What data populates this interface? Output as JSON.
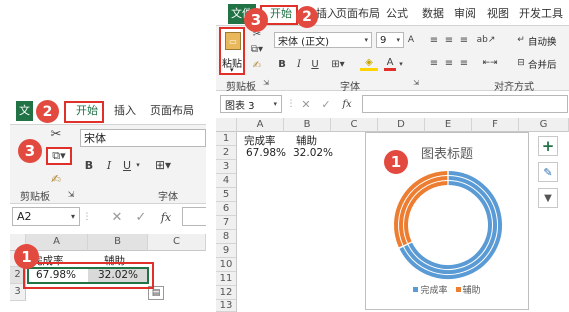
{
  "left": {
    "tabs": {
      "file": "文",
      "home": "开始",
      "insert": "插入",
      "page_layout": "页面布局"
    },
    "clipboard_label": "剪贴板",
    "font_group_label": "字体",
    "font_name": "宋体",
    "bold": "B",
    "italic": "I",
    "underline": "U",
    "namebox": "A2",
    "fx": "fx",
    "columns": [
      "A",
      "B",
      "C"
    ],
    "rows": [
      "1",
      "2",
      "3"
    ],
    "cells": {
      "a1": "完成率",
      "b1": "辅助",
      "a2": "67.98%",
      "b2": "32.02%"
    },
    "badges": {
      "one": "1",
      "two": "2",
      "three": "3"
    }
  },
  "right": {
    "tabs": {
      "file": "文件",
      "home": "开始",
      "insert": "插入",
      "page_layout": "页面布局",
      "formulas": "公式",
      "data": "数据",
      "review": "审阅",
      "view": "视图",
      "developer": "开发工具"
    },
    "paste_label": "粘贴",
    "clipboard_label": "剪贴板",
    "font_group_label": "字体",
    "align_group_label": "对齐方式",
    "font_name": "宋体 (正文)",
    "font_size": "9",
    "bold": "B",
    "italic": "I",
    "underline": "U",
    "wrap_text": "自动换",
    "merge": "合并后",
    "font_a": "A",
    "namebox": "图表 3",
    "fx": "fx",
    "columns": [
      "A",
      "B",
      "C",
      "D",
      "E",
      "F",
      "G"
    ],
    "rows": [
      "1",
      "2",
      "3",
      "4",
      "5",
      "6",
      "7",
      "8",
      "9",
      "10",
      "11",
      "12",
      "13"
    ],
    "cells": {
      "a1": "完成率",
      "b1": "辅助",
      "a2": "67.98%",
      "b2": "32.02%"
    },
    "badges": {
      "one": "1",
      "two": "2",
      "three": "3"
    },
    "side_buttons": {
      "plus": "+",
      "brush": "✎",
      "filter": "▼"
    }
  },
  "chart_data": {
    "type": "doughnut",
    "title": "图表标题",
    "series": [
      {
        "name": "完成率",
        "values": [
          0.6798,
          0.6798,
          0.6798
        ]
      },
      {
        "name": "辅助",
        "values": [
          0.3202,
          0.3202,
          0.3202
        ]
      }
    ],
    "legend": [
      "完成率",
      "辅助"
    ],
    "legend_position": "bottom",
    "colors": {
      "完成率": "#5b9bd5",
      "辅助": "#ed7d31"
    }
  }
}
